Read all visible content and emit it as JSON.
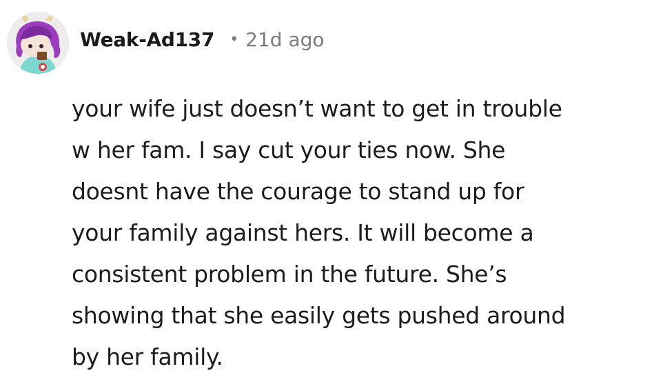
{
  "comment": {
    "author": "Weak-Ad137",
    "separator": "•",
    "age": "21d ago",
    "avatar": {
      "icon": "snoo-avatar-purple-hair",
      "bg_color": "#ededed",
      "hair_color": "#9b3dbd",
      "shirt_color": "#7ed6d0"
    },
    "body_lines": [
      "your wife just doesn’t want to get in trouble",
      "w her fam. I say cut your ties now. She",
      "doesnt have the courage to stand up for",
      "your family against hers. It will become a",
      "consistent problem in the future. She’s",
      "showing that she easily gets pushed around",
      "by her family."
    ]
  }
}
